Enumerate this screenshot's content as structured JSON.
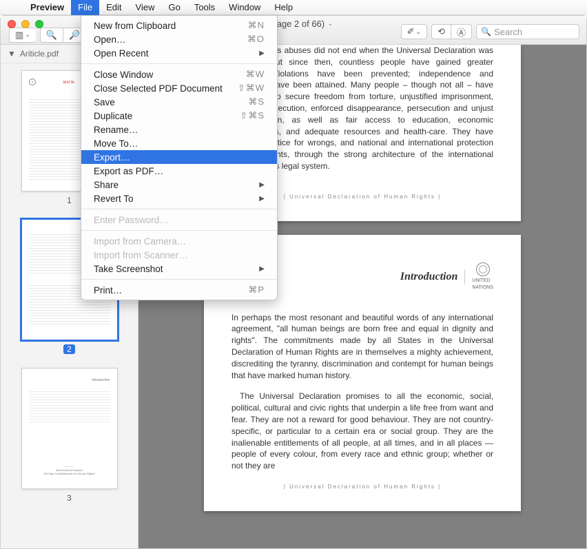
{
  "menubar": {
    "app": "Preview",
    "items": [
      "File",
      "Edit",
      "View",
      "Go",
      "Tools",
      "Window",
      "Help"
    ],
    "active_index": 0
  },
  "window": {
    "title": "pdf (page 2 of 66)",
    "search_placeholder": "Search"
  },
  "toolbar": {
    "zoom_out": "-",
    "zoom_in": "+"
  },
  "sidebar": {
    "filename": "Ariticle.pdf",
    "thumbnails": [
      {
        "page": "1",
        "selected": false,
        "redlabel": "text te"
      },
      {
        "page": "2",
        "selected": true
      },
      {
        "page": "3",
        "selected": false
      }
    ]
  },
  "menu": {
    "items": [
      {
        "label": "New from Clipboard",
        "shortcut": "⌘N"
      },
      {
        "label": "Open…",
        "shortcut": "⌘O"
      },
      {
        "label": "Open Recent",
        "submenu": true
      },
      {
        "sep": true
      },
      {
        "label": "Close Window",
        "shortcut": "⌘W"
      },
      {
        "label": "Close Selected PDF Document",
        "shortcut": "⇧⌘W"
      },
      {
        "label": "Save",
        "shortcut": "⌘S"
      },
      {
        "label": "Duplicate",
        "shortcut": "⇧⌘S"
      },
      {
        "label": "Rename…"
      },
      {
        "label": "Move To…"
      },
      {
        "label": "Export…",
        "highlighted": true
      },
      {
        "label": "Export as PDF…"
      },
      {
        "label": "Share",
        "submenu": true
      },
      {
        "label": "Revert To",
        "submenu": true
      },
      {
        "sep": true
      },
      {
        "label": "Enter Password…",
        "disabled": true
      },
      {
        "sep": true
      },
      {
        "label": "Import from Camera…",
        "disabled": true
      },
      {
        "label": "Import from Scanner…",
        "disabled": true
      },
      {
        "label": "Take Screenshot",
        "submenu": true
      },
      {
        "sep": true
      },
      {
        "label": "Print…",
        "shortcut": "⌘P"
      }
    ]
  },
  "document": {
    "page1": {
      "body": "Human rights abuses did not end when the Universal Declaration was adopted. But since then, countless people have gained greater freedom. Violations have been prevented; independence and autonomy have been attained. Many people – though not all – have been able to secure freedom from torture, unjustified imprisonment, summary execution, enforced disappearance, persecution and unjust discrimination, as well as fair access to education, economic opportunities, and adequate resources and health-care. They have obtained justice for wrongs, and national and international protection for their rights, through the strong architecture of the international human rights legal system.",
      "footer": "| Universal Declaration of Human Rights |"
    },
    "page2": {
      "intro_title": "Introduction",
      "un_label": "UNITED\nNATIONS",
      "p1": "In perhaps the most resonant and beautiful words of any international agreement, \"all human beings are born free and equal in dignity and rights\". The commitments made by all States in the Universal Declaration of Human Rights are in themselves a mighty achievement, discrediting the tyranny, discrimination and contempt for human beings that have marked human history.",
      "p2": "The Universal Declaration promises to all the economic, social, political, cultural and civic rights that underpin a life free from want and fear. They are not a reward for good behaviour. They are not country-specific, or particular to a certain era or social group. They are the inalienable entitlements of all people, at all times, and in all places — people of every colour, from every race and ethnic group; whether or not they are",
      "footer": "| Universal Declaration of Human Rights |"
    }
  }
}
